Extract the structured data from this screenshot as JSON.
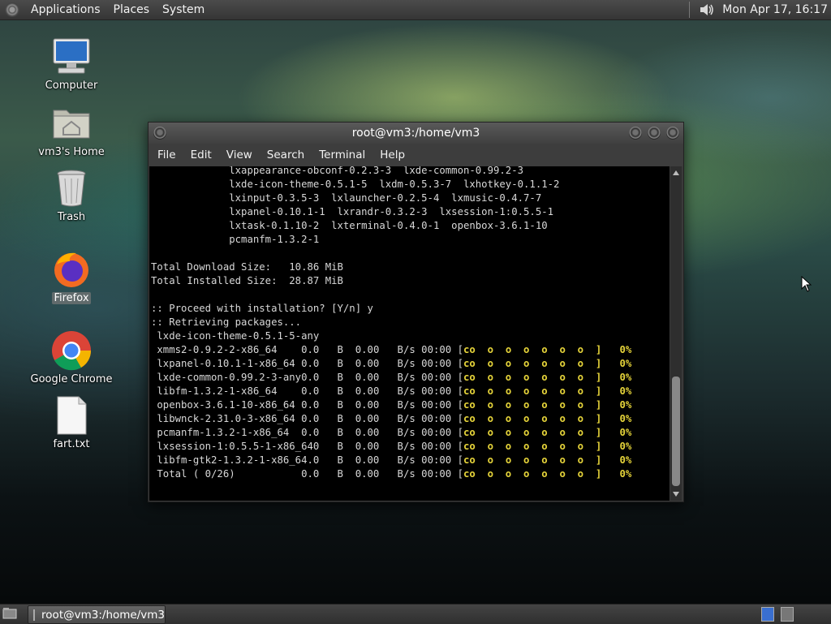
{
  "top_panel": {
    "menus": [
      "Applications",
      "Places",
      "System"
    ],
    "clock": "Mon Apr 17, 16:17"
  },
  "desktop_icons": [
    {
      "label": "Computer",
      "icon": "computer-icon"
    },
    {
      "label": "vm3's Home",
      "icon": "home-folder-icon"
    },
    {
      "label": "Trash",
      "icon": "trash-icon"
    },
    {
      "label": "Firefox",
      "icon": "firefox-icon",
      "selected": true
    },
    {
      "label": "Google Chrome",
      "icon": "chrome-icon"
    },
    {
      "label": "fart.txt",
      "icon": "text-file-icon"
    }
  ],
  "window": {
    "title": "root@vm3:/home/vm3",
    "menus": [
      "File",
      "Edit",
      "View",
      "Search",
      "Terminal",
      "Help"
    ]
  },
  "terminal": {
    "lines": [
      "             lxappearance-obconf-0.2.3-3  lxde-common-0.99.2-3",
      "             lxde-icon-theme-0.5.1-5  lxdm-0.5.3-7  lxhotkey-0.1.1-2",
      "             lxinput-0.3.5-3  lxlauncher-0.2.5-4  lxmusic-0.4.7-7",
      "             lxpanel-0.10.1-1  lxrandr-0.3.2-3  lxsession-1:0.5.5-1",
      "             lxtask-0.1.10-2  lxterminal-0.4.0-1  openbox-3.6.1-10",
      "             pcmanfm-1.3.2-1",
      "",
      "Total Download Size:   10.86 MiB",
      "Total Installed Size:  28.87 MiB",
      "",
      ":: Proceed with installation? [Y/n] y",
      ":: Retrieving packages...",
      " lxde-icon-theme-0.5.1-5-any"
    ],
    "downloads": [
      {
        "name": " xmms2-0.9.2-2-x86_64",
        "stats": "    0.0   B  0.00   B/s 00:00 [",
        "bar": "co  o  o  o  o  o  o  ]   0%"
      },
      {
        "name": " lxpanel-0.10.1-1-x86_64",
        "stats": " 0.0   B  0.00   B/s 00:00 [",
        "bar": "co  o  o  o  o  o  o  ]   0%"
      },
      {
        "name": " lxde-common-0.99.2-3-any",
        "stats": "0.0   B  0.00   B/s 00:00 [",
        "bar": "co  o  o  o  o  o  o  ]   0%"
      },
      {
        "name": " libfm-1.3.2-1-x86_64",
        "stats": "    0.0   B  0.00   B/s 00:00 [",
        "bar": "co  o  o  o  o  o  o  ]   0%"
      },
      {
        "name": " openbox-3.6.1-10-x86_64",
        "stats": " 0.0   B  0.00   B/s 00:00 [",
        "bar": "co  o  o  o  o  o  o  ]   0%"
      },
      {
        "name": " libwnck-2.31.0-3-x86_64",
        "stats": " 0.0   B  0.00   B/s 00:00 [",
        "bar": "co  o  o  o  o  o  o  ]   0%"
      },
      {
        "name": " pcmanfm-1.3.2-1-x86_64",
        "stats": "  0.0   B  0.00   B/s 00:00 [",
        "bar": "co  o  o  o  o  o  o  ]   0%"
      },
      {
        "name": " lxsession-1:0.5.5-1-x86_64",
        "stats": "0   B  0.00   B/s 00:00 [",
        "bar": "co  o  o  o  o  o  o  ]   0%"
      },
      {
        "name": " libfm-gtk2-1.3.2-1-x86_64",
        "stats": ".0   B  0.00   B/s 00:00 [",
        "bar": "co  o  o  o  o  o  o  ]   0%"
      },
      {
        "name": " Total ( 0/26)",
        "stats": "           0.0   B  0.00   B/s 00:00 [",
        "bar": "co  o  o  o  o  o  o  ]   0%"
      }
    ]
  },
  "taskbar": {
    "task_label": "root@vm3:/home/vm3"
  }
}
